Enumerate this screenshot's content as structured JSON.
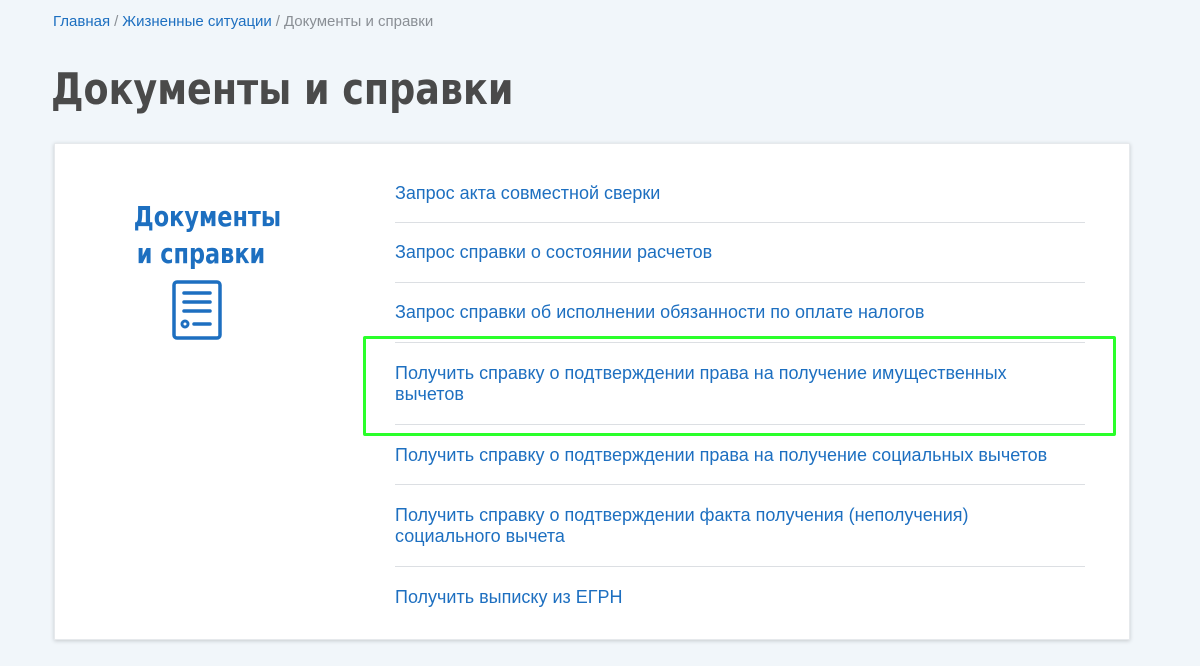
{
  "breadcrumb": {
    "items": [
      "Главная",
      "Жизненные ситуации"
    ],
    "current": "Документы и справки",
    "separator": "/"
  },
  "page_title": "Документы и справки",
  "section": {
    "title": "Документы и справки",
    "icon": "document-list-icon"
  },
  "links": [
    "Запрос акта совместной сверки",
    "Запрос справки о состоянии расчетов",
    "Запрос справки об исполнении обязанности по оплате налогов",
    "Получить справку о подтверждении права на получение имущественных вычетов",
    "Получить справку о подтверждении права на получение социальных вычетов",
    "Получить справку о подтверждении факта получения (неполучения) социального вычета",
    "Получить выписку из ЕГРН"
  ],
  "highlighted_link_index": 3,
  "colors": {
    "accent": "#1d6fc0",
    "title": "#4a4a4a",
    "highlight": "#2aff2a",
    "background": "#f1f6fa"
  }
}
